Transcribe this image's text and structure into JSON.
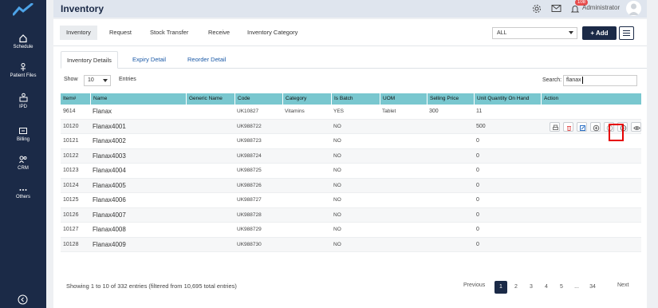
{
  "sidebar": {
    "items": [
      {
        "label": "Schedule",
        "icon": "home-icon"
      },
      {
        "label": "Patient Files",
        "icon": "patient-files-icon"
      },
      {
        "label": "IPD",
        "icon": "bed-icon"
      },
      {
        "label": "Billing",
        "icon": "billing-icon"
      },
      {
        "label": "CRM",
        "icon": "crm-icon"
      },
      {
        "label": "Others",
        "icon": "more-icon"
      }
    ]
  },
  "header": {
    "title": "Inventory",
    "notification_count": "108",
    "user_name": "Administrator"
  },
  "top_tabs": [
    "Inventory",
    "Request",
    "Stock Transfer",
    "Receive",
    "Inventory Category"
  ],
  "filter": {
    "selected": "ALL"
  },
  "add_label": "+ Add",
  "sub_tabs": [
    "Inventory Details",
    "Expiry Detail",
    "Reorder Detail"
  ],
  "list_controls": {
    "show_label": "Show",
    "entries_value": "10",
    "entries_label": "Entries",
    "search_label": "Search:",
    "search_value": "flanax"
  },
  "table": {
    "columns": [
      "Item#",
      "Name",
      "Generic Name",
      "Code",
      "Category",
      "Is Batch",
      "UOM",
      "Selling Price",
      "Unit Quantity On Hand",
      "Action"
    ],
    "rows": [
      {
        "item": "9614",
        "name": "Flanax",
        "generic": "",
        "code": "UK10827",
        "category": "Vitamins",
        "batch": "YES",
        "uom": "Tablet",
        "price": "300",
        "qty": "11"
      },
      {
        "item": "10120",
        "name": "Flanax4001",
        "generic": "",
        "code": "UK988722",
        "category": "",
        "batch": "NO",
        "uom": "",
        "price": "",
        "qty": "500"
      },
      {
        "item": "10121",
        "name": "Flanax4002",
        "generic": "",
        "code": "UK988723",
        "category": "",
        "batch": "NO",
        "uom": "",
        "price": "",
        "qty": "0"
      },
      {
        "item": "10122",
        "name": "Flanax4003",
        "generic": "",
        "code": "UK988724",
        "category": "",
        "batch": "NO",
        "uom": "",
        "price": "",
        "qty": "0"
      },
      {
        "item": "10123",
        "name": "Flanax4004",
        "generic": "",
        "code": "UK988725",
        "category": "",
        "batch": "NO",
        "uom": "",
        "price": "",
        "qty": "0"
      },
      {
        "item": "10124",
        "name": "Flanax4005",
        "generic": "",
        "code": "UK988726",
        "category": "",
        "batch": "NO",
        "uom": "",
        "price": "",
        "qty": "0"
      },
      {
        "item": "10125",
        "name": "Flanax4006",
        "generic": "",
        "code": "UK988727",
        "category": "",
        "batch": "NO",
        "uom": "",
        "price": "",
        "qty": "0"
      },
      {
        "item": "10126",
        "name": "Flanax4007",
        "generic": "",
        "code": "UK988728",
        "category": "",
        "batch": "NO",
        "uom": "",
        "price": "",
        "qty": "0"
      },
      {
        "item": "10127",
        "name": "Flanax4008",
        "generic": "",
        "code": "UK988729",
        "category": "",
        "batch": "NO",
        "uom": "",
        "price": "",
        "qty": "0"
      },
      {
        "item": "10128",
        "name": "Flanax4009",
        "generic": "",
        "code": "UK988730",
        "category": "",
        "batch": "NO",
        "uom": "",
        "price": "",
        "qty": "0"
      }
    ]
  },
  "footer": {
    "info": "Showing 1 to 10 of 332 entries (filtered from 10,695 total entries)",
    "previous": "Previous",
    "pages": [
      "1",
      "2",
      "3",
      "4",
      "5",
      "...",
      "34"
    ],
    "next": "Next"
  },
  "colors": {
    "sidebar": "#1b2a47",
    "table_header": "#79c7cf",
    "highlight": "#e60000"
  }
}
